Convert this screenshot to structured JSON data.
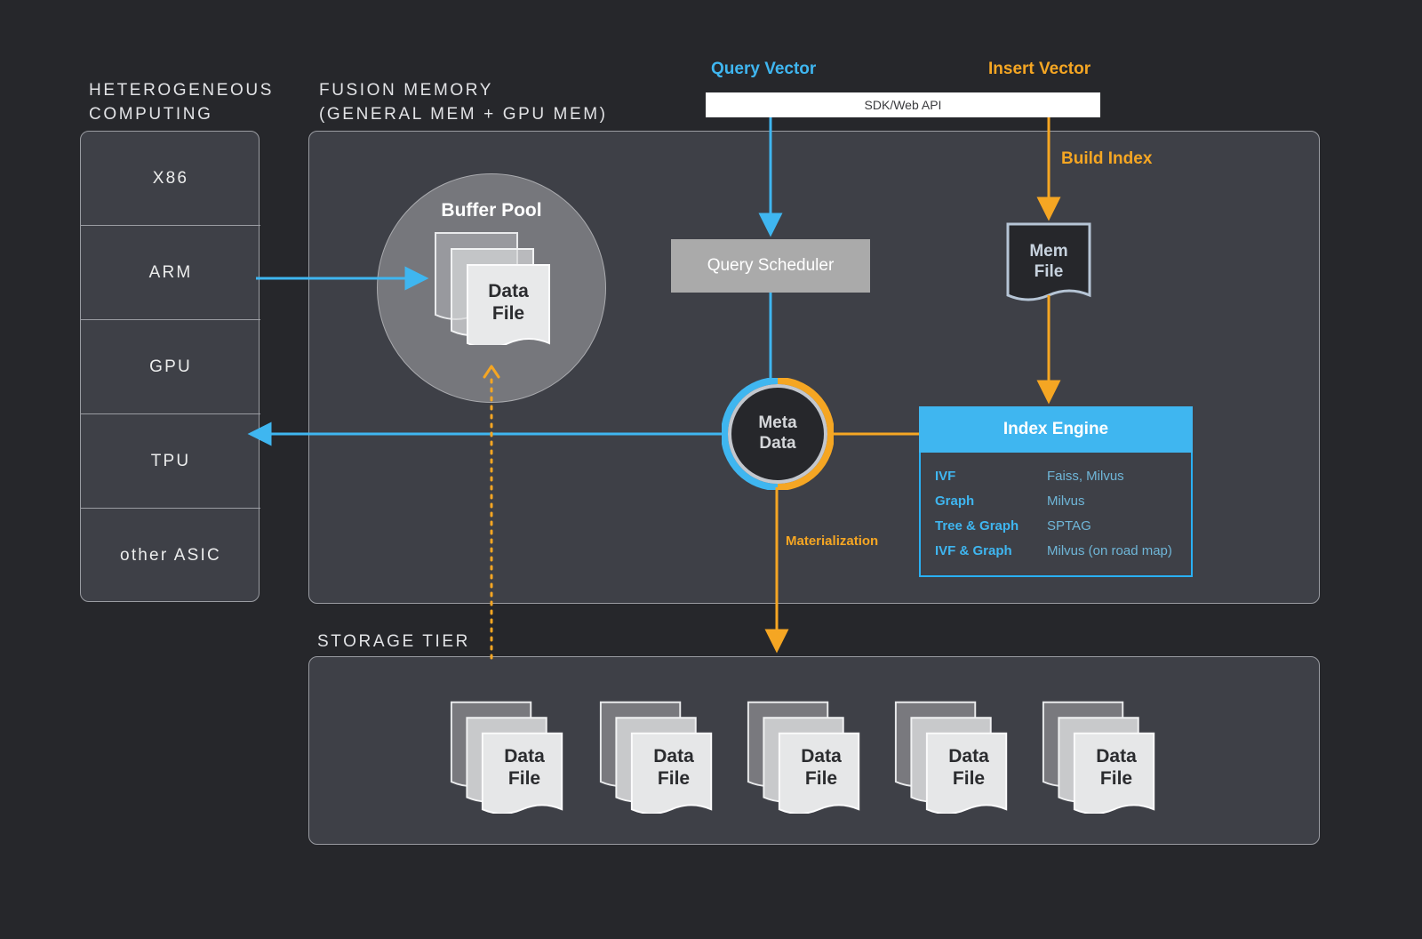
{
  "colors": {
    "background": "#26272b",
    "panel_fill": "#3e4047",
    "panel_border": "#9a9ca2",
    "accent_blue": "#3fb6f0",
    "accent_orange": "#f5a623",
    "buffer_pool_fill": "#76777c",
    "query_scheduler_fill": "#aaaaaa",
    "index_engine_header": "#3fb6f0",
    "metadata_fill": "#26272b",
    "text_light": "#e2e3e6"
  },
  "sections": {
    "heterogeneous": {
      "title": "HETEROGENEOUS\nCOMPUTING",
      "items": [
        {
          "label": "X86"
        },
        {
          "label": "ARM"
        },
        {
          "label": "GPU"
        },
        {
          "label": "TPU"
        },
        {
          "label": "other ASIC"
        }
      ]
    },
    "fusion_memory": {
      "title": "FUSION MEMORY\n(GENERAL MEM + GPU MEM)"
    },
    "storage_tier": {
      "title": "STORAGE TIER"
    }
  },
  "api": {
    "bar_label": "SDK/Web API",
    "query_vector_label": "Query Vector",
    "insert_vector_label": "Insert Vector"
  },
  "nodes": {
    "buffer_pool": {
      "label": "Buffer Pool",
      "data_file_line1": "Data",
      "data_file_line2": "File"
    },
    "query_scheduler": {
      "label": "Query Scheduler"
    },
    "metadata": {
      "line1": "Meta",
      "line2": "Data"
    },
    "mem_file": {
      "line1": "Mem",
      "line2": "File"
    },
    "index_engine": {
      "title": "Index Engine",
      "columns": [
        "index_type",
        "implementation"
      ],
      "rows": [
        {
          "index_type": "IVF",
          "implementation": "Faiss, Milvus"
        },
        {
          "index_type": "Graph",
          "implementation": "Milvus"
        },
        {
          "index_type": "Tree & Graph",
          "implementation": "SPTAG"
        },
        {
          "index_type": "IVF & Graph",
          "implementation": "Milvus (on road map)"
        }
      ]
    }
  },
  "edges": {
    "build_index_label": "Build Index",
    "materialization_label": "Materialization"
  },
  "storage_files": [
    {
      "line1": "Data",
      "line2": "File"
    },
    {
      "line1": "Data",
      "line2": "File"
    },
    {
      "line1": "Data",
      "line2": "File"
    },
    {
      "line1": "Data",
      "line2": "File"
    },
    {
      "line1": "Data",
      "line2": "File"
    }
  ]
}
